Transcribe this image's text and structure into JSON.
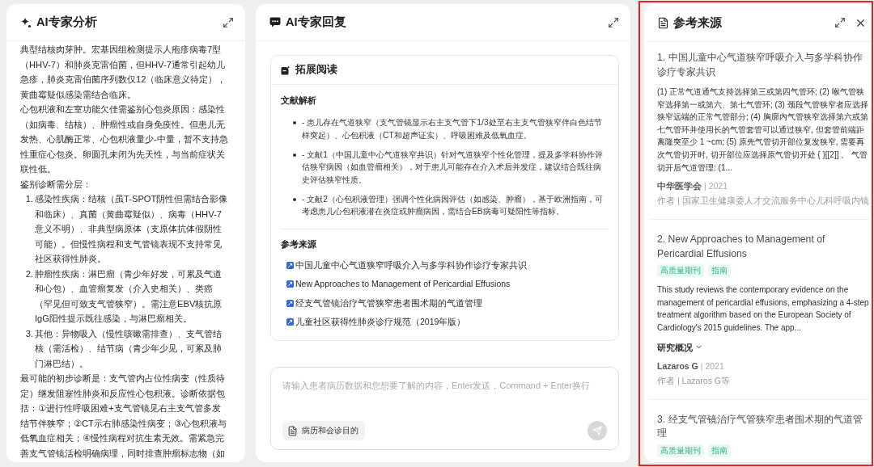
{
  "analysis_panel": {
    "title": "AI专家分析",
    "blocks": [
      {
        "kind": "paragraph",
        "text": "典型结核肉芽肿。宏基因组检测提示人疱疹病毒7型（HHV-7）和肺炎克雷伯菌，但HHV-7通常引起幼儿急疹，肺炎克雷伯菌序列数仅12（临床意义待定），黄曲霉疑似感染需结合临床。"
      },
      {
        "kind": "paragraph",
        "text": "心包积液和左室功能欠佳需鉴别心包炎原因：感染性（如病毒、结核）、肿瘤性或自身免疫性。但患儿无发热、心肌酶正常、心包积液量少-中量，暂不支持急性重症心包炎。卵圆孔未闭为先天性，与当前症状关联性低。"
      },
      {
        "kind": "paragraph",
        "text": "鉴别诊断需分层："
      },
      {
        "kind": "numbered_list",
        "items": [
          {
            "number": "1.",
            "text": "感染性疾病：结核（虽T-SPOT阴性但需结合影像和临床）、真菌（黄曲霉疑似）、病毒（HHV-7意义不明）、非典型病原体（支原体抗体假阴性可能）。但慢性病程和支气管镜表现不支持常见社区获得性肺炎。"
          },
          {
            "number": "2.",
            "text": "肿瘤性疾病：淋巴瘤（青少年好发，可累及气道和心包）、血管瘤复发（介入史相关）、类癌（罕见但可致支气管狭窄）。需注意EBV核抗原IgG阳性提示既往感染，与淋巴瘤相关。"
          },
          {
            "number": "3.",
            "text": "其他：异物吸入（慢性咳嗽需排查）、支气管结核（需活检）、结节病（青少年少见，可累及肺门淋巴结）。"
          }
        ]
      },
      {
        "kind": "paragraph",
        "text": "最可能的初步诊断是：支气管内占位性病变（性质待定）继发阻塞性肺炎和反应性心包积液。诊断依据包括：①进行性呼吸困难+支气管镜见右主支气管多发结节伴狭窄；②CT示右肺感染性病变；③心包积液与低氧血症相关；④慢性病程对抗生素无效。需紧急完善支气管镜活检明确病理，同时排查肿瘤标志物（如"
      }
    ]
  },
  "reply_panel": {
    "title": "AI专家回复",
    "reading_card": {
      "title": "拓展阅读",
      "analysis_heading": "文献解析",
      "bullets": [
        "- 患儿存在气道狭窄（支气管镜显示右主支气管下1/3处至右主支气管狭窄伴白色结节样突起）、心包积液（CT和超声证实）、呼吸困难及低氧血症。",
        "- 文献1（中国儿童中心气道狭窄共识）针对气道狭窄个性化管理，提及多学科协作评估狭窄病因（如血管瘤相关），对于患儿可能存在介入术后并发症，建议结合既往病史评估狭窄性质。",
        "- 文献2（心包积液管理）强调个性化病因评估（如感染、肿瘤），基于欧洲指南，可考虑患儿心包积液潜在炎症或肿瘤病因，需结合EB病毒可疑阳性等指标。"
      ],
      "sources_heading": "参考来源",
      "links": [
        "中国儿童中心气道狭窄呼吸介入与多学科协作诊疗专家共识",
        "New Approaches to Management of Pericardial Effusions",
        "经支气管镜治疗气管狭窄患者围术期的气道管理",
        "儿童社区获得性肺炎诊疗规范（2019年版）"
      ]
    },
    "composer": {
      "placeholder": "请输入患者病历数据和您想要了解的内容，Enter发送，Command + Enter换行",
      "attachment_button": "病历和会诊目的",
      "send_disabled": true
    }
  },
  "sources_panel": {
    "title": "参考来源",
    "highlighted": true,
    "items": [
      {
        "title": "1. 中国儿童中心气道狭窄呼吸介入与多学科协作诊疗专家共识",
        "summary": "(1) 正常气道通气支持选择第三或第四气管环; (2) 喉气管狭窄选择第一或第六、第七气管环; (3) 颈段气管狭窄者应选择狭窄远端的正常气管部分; (4) 胸廓内气管狭窄选择第六或第七气管环并使用长的气管套管可以通过狭窄, 但套管前端距离隆突至少 1 ~cm; (5) 原先气管切开部位复发狭窄, 需要再次气管切开时, 切开部位应选择原气管切开处 { }[[2]] 。 气管切开后气道管理: (1...",
        "publisher": "中华医学会",
        "year": "| 2021",
        "author_line": "作者 | 国家卫生健康委人才交流服务中心儿科呼吸内镜"
      },
      {
        "title": "2. New Approaches to Management of Pericardial Effusions",
        "tags": [
          "高质量期刊",
          "指南"
        ],
        "summary": "This study reviews the contemporary evidence on the management of pericardial effusions, emphasizing a 4-step treatment algorithm based on the European Society of Cardiology's 2015 guidelines. The app...",
        "details_toggle": {
          "label": "研究概况",
          "expanded": false
        },
        "publisher": "Lazaros G",
        "year": "| 2021",
        "author_line": "作者 | Lazaros G等"
      },
      {
        "title": "3. 经支气管镜治疗气管狭窄患者围术期的气道管理",
        "tags": [
          "高质量期刊",
          "指南"
        ]
      }
    ]
  }
}
